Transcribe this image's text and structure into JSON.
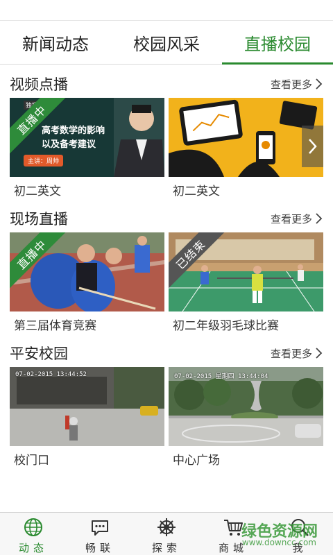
{
  "tabs": [
    {
      "label": "新闻动态"
    },
    {
      "label": "校园风采"
    },
    {
      "label": "直播校园"
    }
  ],
  "sections": {
    "video": {
      "title": "视频点播",
      "more": "查看更多",
      "cards": [
        {
          "caption": "初二英文",
          "badge": "直播中"
        },
        {
          "caption": "初二英文"
        }
      ]
    },
    "live": {
      "title": "现场直播",
      "more": "查看更多",
      "cards": [
        {
          "caption": "第三届体育竞赛",
          "badge": "直播中"
        },
        {
          "caption": "初二年级羽毛球比赛",
          "badge": "已结束"
        }
      ]
    },
    "safe": {
      "title": "平安校园",
      "more": "查看更多",
      "cards": [
        {
          "caption": "校门口",
          "timestamp": "07-02-2015 13:44:52"
        },
        {
          "caption": "中心广场",
          "timestamp": "07-02-2015 星期四 13:44:04"
        }
      ]
    }
  },
  "thumb_text": {
    "lecture_tag": "独播",
    "lecture_line1": "高考数学的影响",
    "lecture_line2": "以及备考建议",
    "lecture_speaker": "主讲：周帅"
  },
  "bottom_nav": [
    {
      "label": "动态",
      "icon": "globe-icon"
    },
    {
      "label": "畅联",
      "icon": "chat-icon"
    },
    {
      "label": "探索",
      "icon": "helm-icon"
    },
    {
      "label": "商城",
      "icon": "cart-icon"
    },
    {
      "label": "我",
      "icon": "search-icon"
    }
  ],
  "watermark": {
    "text": "绿色资源网",
    "url": "www.downcc.com"
  },
  "colors": {
    "accent": "#2a8a2f",
    "ribbon_live": "#2e8b3a",
    "ribbon_ended": "#555555"
  }
}
